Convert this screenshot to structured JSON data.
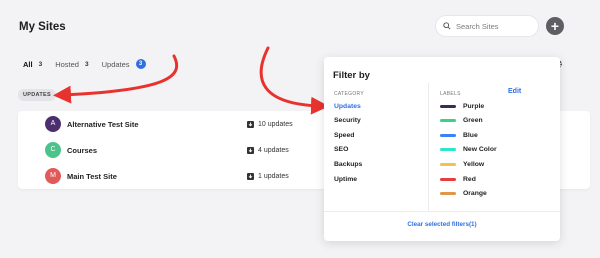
{
  "page_title": "My Sites",
  "search": {
    "placeholder": "Search Sites"
  },
  "add_label": "+",
  "tabs": [
    {
      "label": "All",
      "count": "3"
    },
    {
      "label": "Hosted",
      "count": "3"
    },
    {
      "label": "Updates",
      "count": "3"
    }
  ],
  "chip": "UPDATES",
  "sites": [
    {
      "initial": "A",
      "name": "Alternative Test Site",
      "updates": "10 updates",
      "avatar_color": "#4c2f6e",
      "bar_color": "#222222"
    },
    {
      "initial": "C",
      "name": "Courses",
      "updates": "4 updates",
      "avatar_color": "#4cc38a",
      "bar_color": "#3ecf8e"
    },
    {
      "initial": "M",
      "name": "Main Test Site",
      "updates": "1 updates",
      "avatar_color": "#e05a5a",
      "bar_color": "#e03d3d"
    }
  ],
  "filter": {
    "title": "Filter by",
    "category_header": "CATEGORY",
    "labels_header": "LABELS",
    "edit": "Edit",
    "categories": [
      "Updates",
      "Security",
      "Speed",
      "SEO",
      "Backups",
      "Uptime"
    ],
    "labels": [
      {
        "name": "Purple",
        "color": "#3d2a55"
      },
      {
        "name": "Green",
        "color": "#3ecf8e"
      },
      {
        "name": "Blue",
        "color": "#3b82f6"
      },
      {
        "name": "New Color",
        "color": "#2ee6c9"
      },
      {
        "name": "Yellow",
        "color": "#f2c14e"
      },
      {
        "name": "Red",
        "color": "#e53e3e"
      },
      {
        "name": "Orange",
        "color": "#e0954a"
      }
    ],
    "clear": "Clear selected filters(1)"
  },
  "colors": {
    "accent": "#2f6fe4",
    "annotation_arrow": "#e8322e"
  }
}
